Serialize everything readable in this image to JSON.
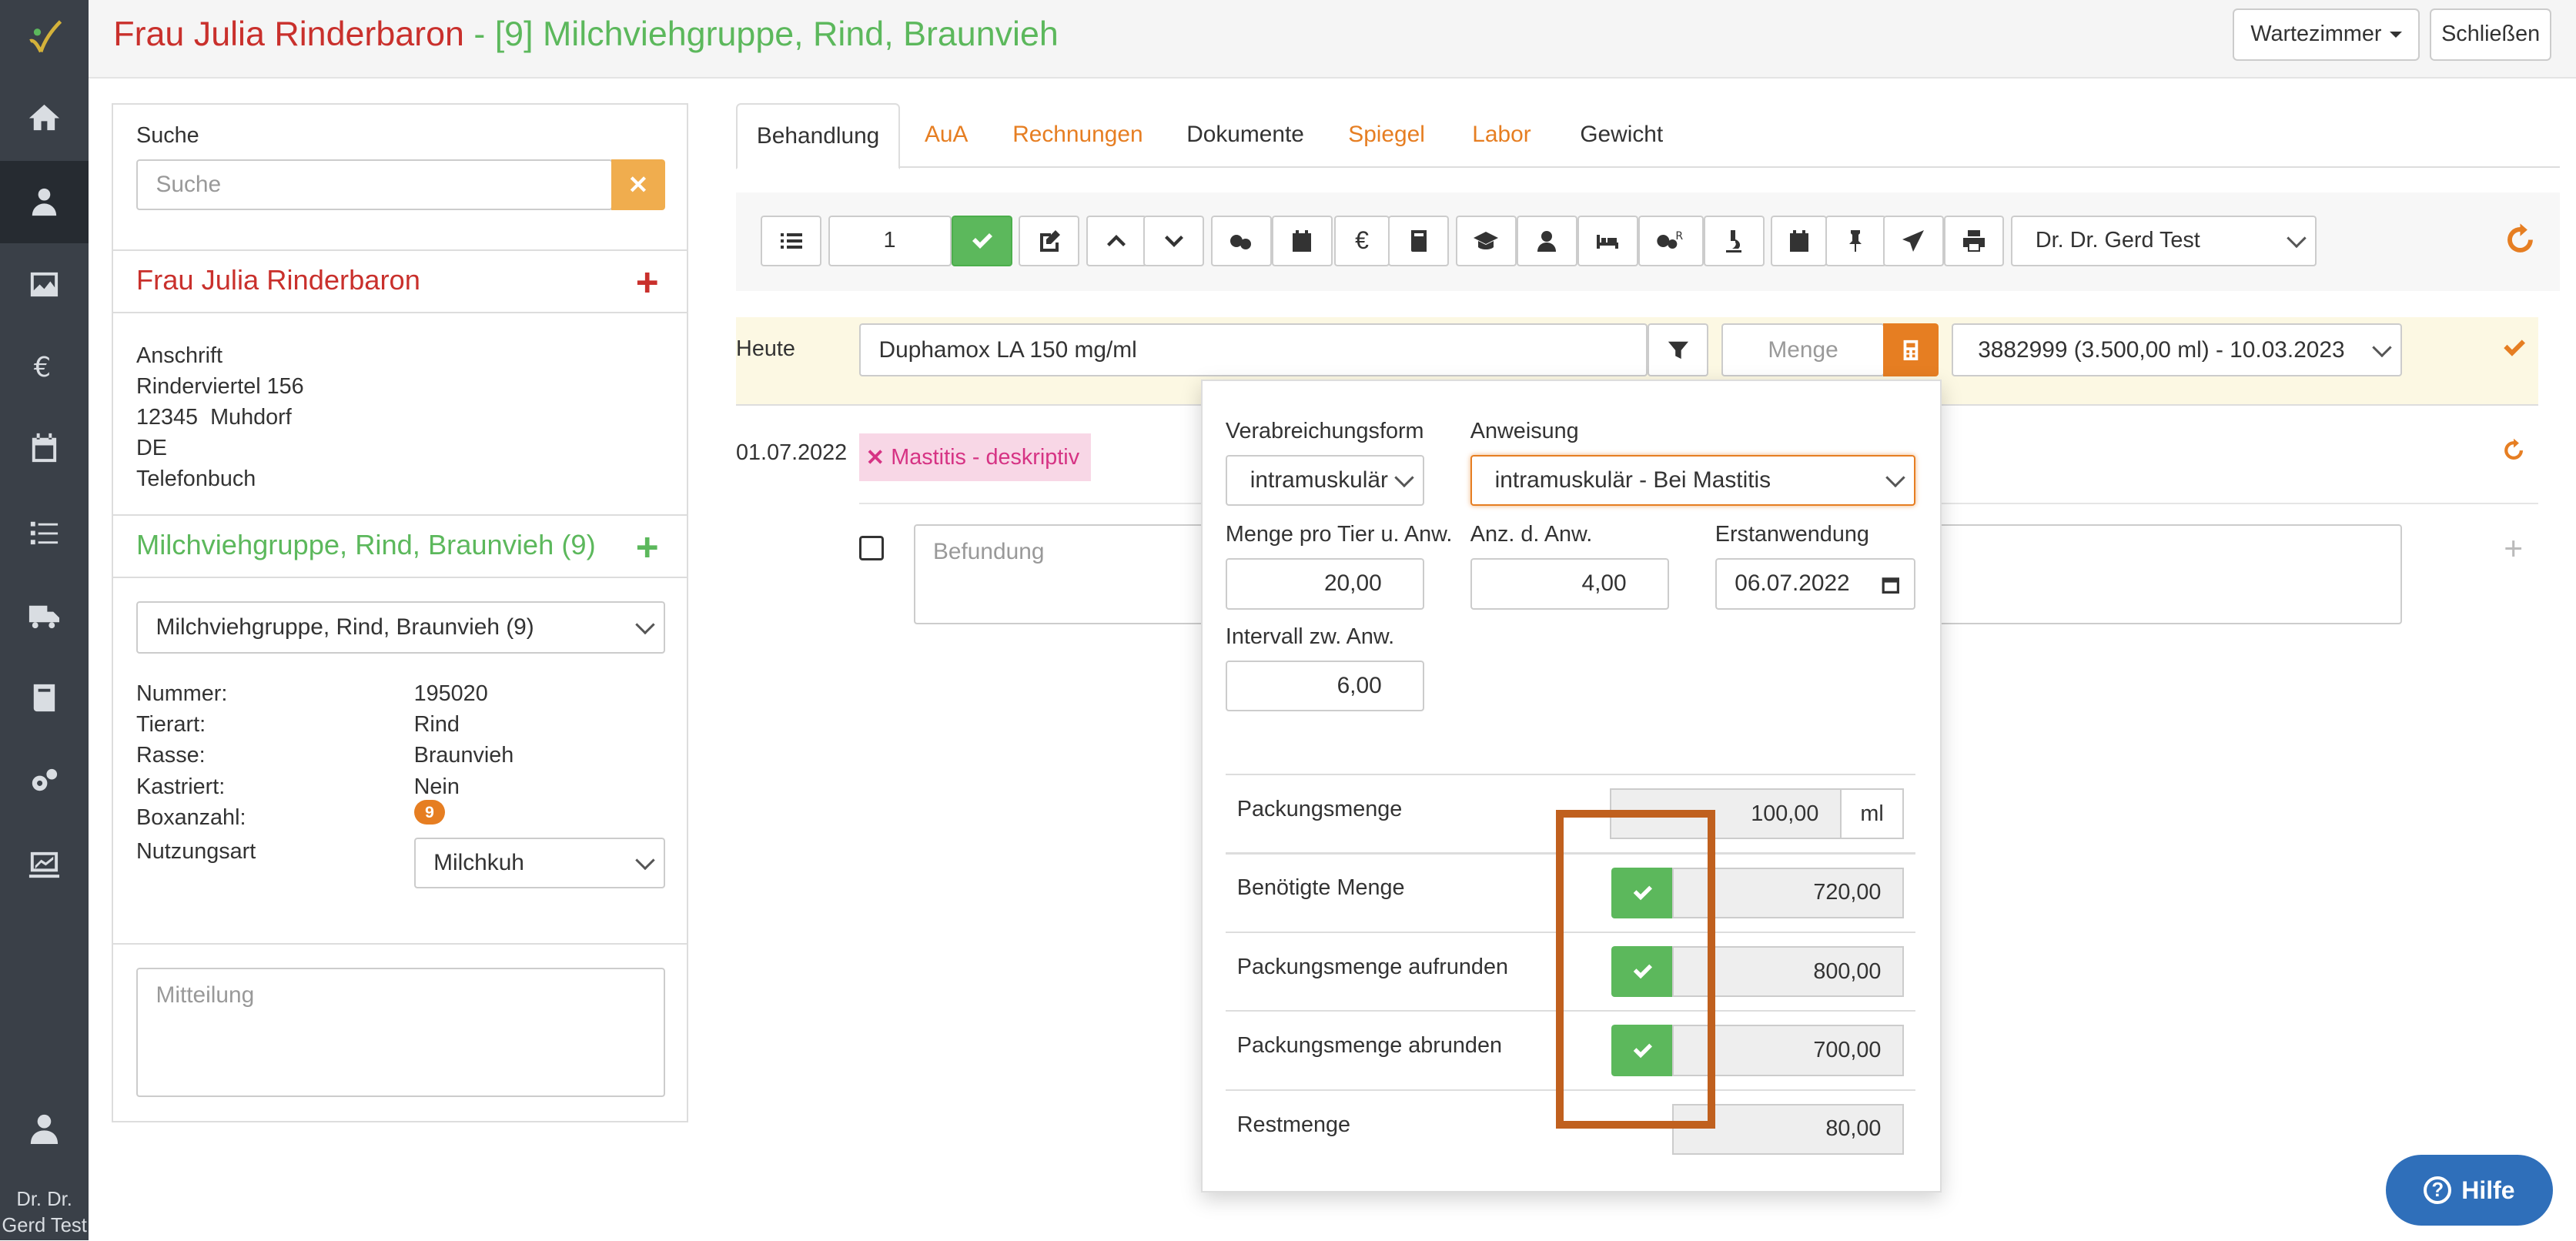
{
  "header": {
    "title_client": "Frau Julia Rinderbaron",
    "title_sep": " - ",
    "title_group": "[9] Milchviehgruppe, Rind, Braunvieh",
    "waiting_room_label": "Wartezimmer",
    "close_label": "Schließen"
  },
  "sidebar": {
    "items": [
      "home-icon",
      "client-icon",
      "image-icon",
      "euro-icon",
      "calendar-icon",
      "tasks-icon",
      "truck-icon",
      "book-icon",
      "cogs-icon",
      "chart-icon"
    ],
    "user_line1": "Dr. Dr.",
    "user_line2": "Gerd Test"
  },
  "left": {
    "search_label": "Suche",
    "search_placeholder": "Suche",
    "client_name": "Frau Julia Rinderbaron",
    "address_label": "Anschrift",
    "street": "Rinderviertel 156",
    "city": "12345  Muhdorf",
    "country": "DE",
    "phonebook": "Telefonbuch",
    "group_title": "Milchviehgruppe, Rind, Braunvieh (9)",
    "group_select": "Milchviehgruppe, Rind, Braunvieh (9)",
    "details": [
      {
        "label": "Nummer:",
        "value": "195020"
      },
      {
        "label": "Tierart:",
        "value": "Rind"
      },
      {
        "label": "Rasse:",
        "value": "Braunvieh"
      },
      {
        "label": "Kastriert:",
        "value": "Nein"
      }
    ],
    "box_label": "Boxanzahl:",
    "box_count": "9",
    "usage_label": "Nutzungsart",
    "usage_value": "Milchkuh",
    "message_placeholder": "Mitteilung"
  },
  "tabs": [
    {
      "label": "Behandlung",
      "active": true
    },
    {
      "label": "AuA"
    },
    {
      "label": "Rechnungen"
    },
    {
      "label": "Dokumente"
    },
    {
      "label": "Spiegel"
    },
    {
      "label": "Labor"
    },
    {
      "label": "Gewicht"
    }
  ],
  "toolbar": {
    "count_value": "1",
    "doctor": "Dr. Dr. Gerd Test"
  },
  "entry": {
    "today_label": "Heute",
    "drug": "Duphamox LA 150 mg/ml",
    "qty_placeholder": "Menge",
    "batch": "3882999 (3.500,00 ml) - 10.03.2023",
    "date": "01.07.2022",
    "diagnosis_tag": "Mastitis - deskriptiv",
    "finding_placeholder": "Befundung"
  },
  "popup": {
    "admin_form_label": "Verabreichungsform",
    "admin_form_value": "intramuskulär",
    "instruction_label": "Anweisung",
    "instruction_value": "intramuskulär - Bei Mastitis",
    "amount_label": "Menge pro Tier u. Anw.",
    "amount_value": "20,00",
    "count_label": "Anz. d. Anw.",
    "count_value": "4,00",
    "first_label": "Erstanwendung",
    "first_value": "06.07.2022",
    "interval_label": "Intervall zw. Anw.",
    "interval_value": "6,00",
    "pack_label": "Packungsmenge",
    "pack_value": "100,00",
    "pack_unit": "ml",
    "needed_label": "Benötigte Menge",
    "needed_value": "720,00",
    "roundup_label": "Packungsmenge aufrunden",
    "roundup_value": "800,00",
    "rounddown_label": "Packungsmenge abrunden",
    "rounddown_value": "700,00",
    "rest_label": "Restmenge",
    "rest_value": "80,00"
  },
  "help_label": "Hilfe",
  "colors": {
    "accent_orange": "#e67e22",
    "red": "#c9302c",
    "green": "#5cb85c",
    "highlight": "#c0601e"
  }
}
